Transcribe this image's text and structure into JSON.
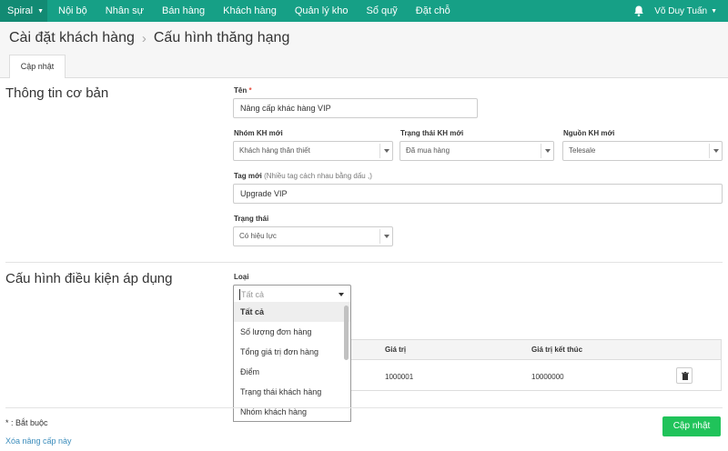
{
  "nav": {
    "brand": "Spiral",
    "items": [
      "Nội bộ",
      "Nhân sự",
      "Bán hàng",
      "Khách hàng",
      "Quản lý kho",
      "Sổ quỹ",
      "Đặt chỗ"
    ],
    "user": "Võ Duy Tuấn"
  },
  "breadcrumb": {
    "parent": "Cài đặt khách hàng",
    "current": "Cấu hình thăng hạng"
  },
  "tabs": {
    "update": "Cập nhật"
  },
  "basic": {
    "title": "Thông tin cơ bản",
    "name_label": "Tên",
    "name_required": "*",
    "name_value": "Nâng cấp khác hàng VIP",
    "group_label": "Nhóm KH mới",
    "group_value": "Khách hàng thân thiết",
    "status_kh_label": "Trạng thái KH mới",
    "status_kh_value": "Đã mua hàng",
    "source_label": "Nguồn KH mới",
    "source_value": "Telesale",
    "tag_label": "Tag mới",
    "tag_hint": "(Nhiều tag cách nhau bằng dấu ,)",
    "tag_value": "Upgrade VIP",
    "state_label": "Trạng thái",
    "state_value": "Có hiệu lực"
  },
  "conditions": {
    "title": "Cấu hình điều kiện áp dụng",
    "type_label": "Loại",
    "type_placeholder": "Tất cả",
    "options": [
      "Tất cả",
      "Số lượng đơn hàng",
      "Tổng giá trị đơn hàng",
      "Điểm",
      "Trạng thái khách hàng",
      "Nhóm khách hàng"
    ],
    "table": {
      "headers": [
        "Giá trị",
        "Giá trị kết thúc"
      ],
      "row": [
        "1000001",
        "10000000"
      ]
    }
  },
  "footer": {
    "required_note": "* : Bắt buộc",
    "delete_link": "Xóa nâng cấp này",
    "submit": "Cập nhật"
  },
  "colors": {
    "nav": "#16a086",
    "submit": "#20c35a",
    "link": "#3c8dbc"
  }
}
